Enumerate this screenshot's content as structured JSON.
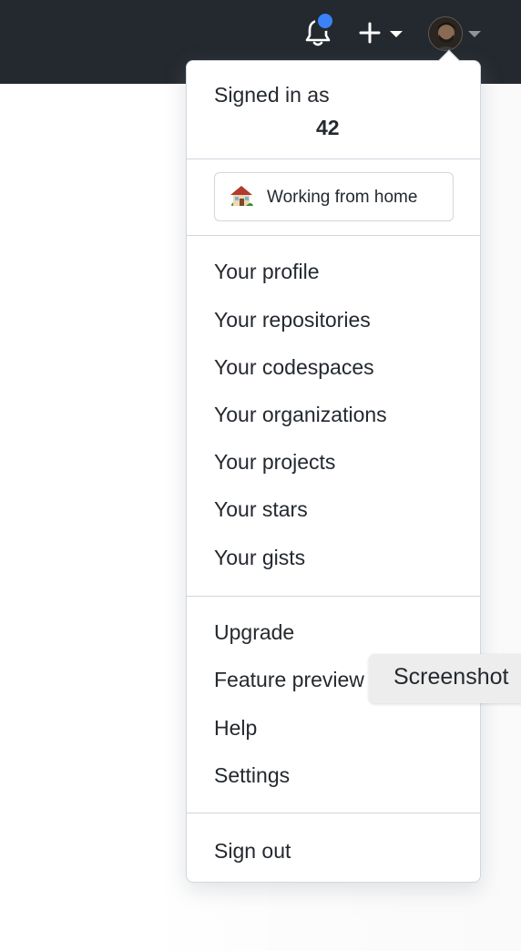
{
  "header": {
    "notifications_icon": "bell-icon",
    "notifications_unread_color": "#3b82f6",
    "create_icon": "plus-icon",
    "avatar_icon": "user-avatar"
  },
  "user_menu": {
    "signed_in_label": "Signed in as",
    "username": "42",
    "status": {
      "emoji_icon": "house-with-garden-icon",
      "text": "Working from home"
    },
    "group_1": [
      "Your profile",
      "Your repositories",
      "Your codespaces",
      "Your organizations",
      "Your projects",
      "Your stars",
      "Your gists"
    ],
    "group_2": [
      "Upgrade",
      "Feature preview",
      "Help",
      "Settings"
    ],
    "sign_out": "Sign out"
  },
  "tooltip": {
    "text": "Screenshot"
  },
  "colors": {
    "header_bg": "#24292f",
    "text": "#24292f",
    "border": "#d0d7de"
  }
}
